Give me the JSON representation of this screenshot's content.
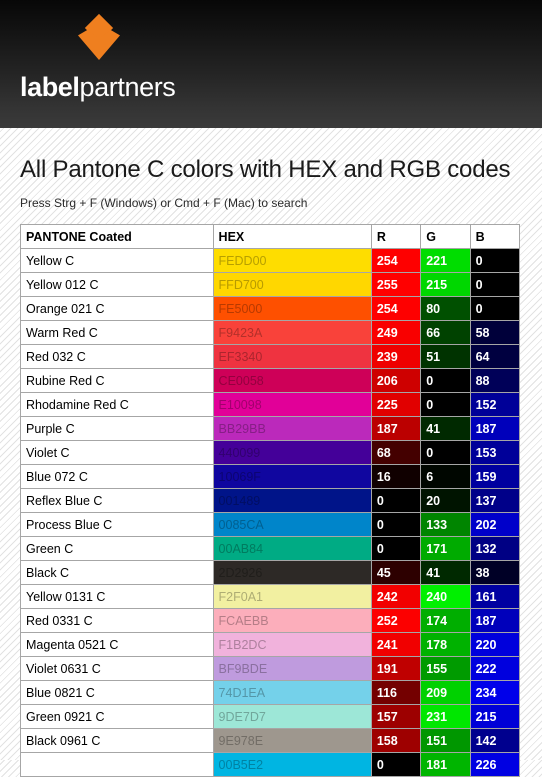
{
  "header": {
    "logo_icon": "labelpartners-diamond-logo",
    "brand_bold": "label",
    "brand_light": "partners"
  },
  "main": {
    "title": "All Pantone C colors with HEX and RGB codes",
    "subtitle": "Press Strg + F (Windows) or Cmd + F (Mac) to search"
  },
  "table": {
    "columns": [
      "PANTONE Coated",
      "HEX",
      "R",
      "G",
      "B"
    ],
    "rows": [
      {
        "name": "Yellow C",
        "hex": "FEDD00",
        "r": "254",
        "g": "221",
        "b": "0"
      },
      {
        "name": "Yellow 012 C",
        "hex": "FFD700",
        "r": "255",
        "g": "215",
        "b": "0"
      },
      {
        "name": "Orange 021 C",
        "hex": "FE5000",
        "r": "254",
        "g": "80",
        "b": "0"
      },
      {
        "name": "Warm Red C",
        "hex": "F9423A",
        "r": "249",
        "g": "66",
        "b": "58"
      },
      {
        "name": "Red 032 C",
        "hex": "EF3340",
        "r": "239",
        "g": "51",
        "b": "64"
      },
      {
        "name": "Rubine Red C",
        "hex": "CE0058",
        "r": "206",
        "g": "0",
        "b": "88"
      },
      {
        "name": "Rhodamine Red C",
        "hex": "E10098",
        "r": "225",
        "g": "0",
        "b": "152"
      },
      {
        "name": "Purple C",
        "hex": "BB29BB",
        "r": "187",
        "g": "41",
        "b": "187"
      },
      {
        "name": "Violet C",
        "hex": "440099",
        "r": "68",
        "g": "0",
        "b": "153"
      },
      {
        "name": "Blue 072 C",
        "hex": "10069F",
        "r": "16",
        "g": "6",
        "b": "159"
      },
      {
        "name": "Reflex Blue C",
        "hex": "001489",
        "r": "0",
        "g": "20",
        "b": "137"
      },
      {
        "name": "Process Blue C",
        "hex": "0085CA",
        "r": "0",
        "g": "133",
        "b": "202"
      },
      {
        "name": "Green C",
        "hex": "00AB84",
        "r": "0",
        "g": "171",
        "b": "132"
      },
      {
        "name": "Black C",
        "hex": "2D2926",
        "r": "45",
        "g": "41",
        "b": "38"
      },
      {
        "name": "Yellow 0131 C",
        "hex": "F2F0A1",
        "r": "242",
        "g": "240",
        "b": "161"
      },
      {
        "name": "Red 0331 C",
        "hex": "FCAEBB",
        "r": "252",
        "g": "174",
        "b": "187"
      },
      {
        "name": "Magenta 0521 C",
        "hex": "F1B2DC",
        "r": "241",
        "g": "178",
        "b": "220"
      },
      {
        "name": "Violet 0631 C",
        "hex": "BF9BDE",
        "r": "191",
        "g": "155",
        "b": "222"
      },
      {
        "name": "Blue 0821 C",
        "hex": "74D1EA",
        "r": "116",
        "g": "209",
        "b": "234"
      },
      {
        "name": "Green 0921 C",
        "hex": "9DE7D7",
        "r": "157",
        "g": "231",
        "b": "215"
      },
      {
        "name": "Black 0961 C",
        "hex": "9E978E",
        "r": "158",
        "g": "151",
        "b": "142"
      },
      {
        "name": "",
        "hex": "00B5E2",
        "r": "0",
        "g": "181",
        "b": "226"
      }
    ]
  }
}
